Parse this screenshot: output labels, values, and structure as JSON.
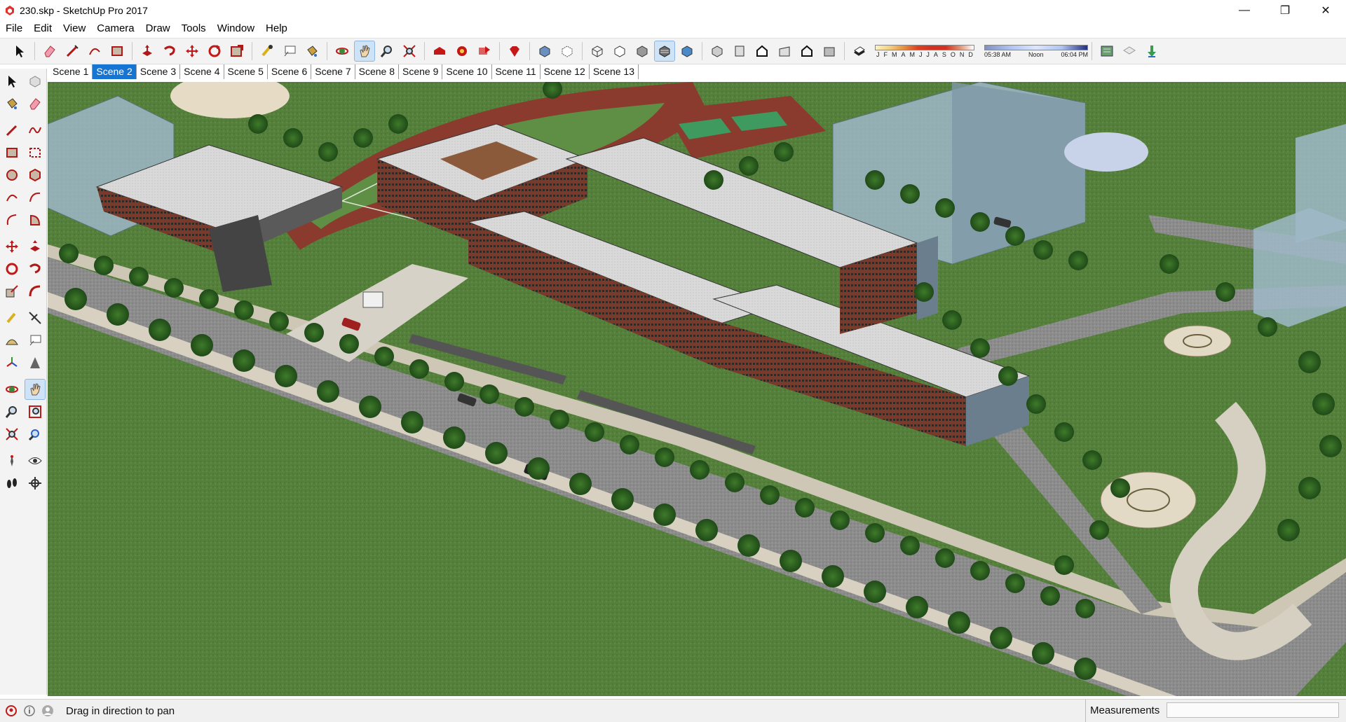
{
  "window": {
    "title": "230.skp - SketchUp Pro 2017",
    "controls": {
      "minimize": "—",
      "maximize": "❐",
      "close": "✕"
    }
  },
  "menu": [
    "File",
    "Edit",
    "View",
    "Camera",
    "Draw",
    "Tools",
    "Window",
    "Help"
  ],
  "shadow": {
    "months": [
      "J",
      "F",
      "M",
      "A",
      "M",
      "J",
      "J",
      "A",
      "S",
      "O",
      "N",
      "D"
    ],
    "time_start": "05:38 AM",
    "time_mid": "Noon",
    "time_end": "06:04 PM"
  },
  "scenes": [
    "Scene 1",
    "Scene 2",
    "Scene 3",
    "Scene 4",
    "Scene 5",
    "Scene 6",
    "Scene 7",
    "Scene 8",
    "Scene 9",
    "Scene 10",
    "Scene 11",
    "Scene 12",
    "Scene 13"
  ],
  "active_scene": 1,
  "status": {
    "message": "Drag in direction to pan",
    "measurements_label": "Measurements",
    "measurements_value": ""
  },
  "colors": {
    "accent": "#1674d2",
    "grass": "#4f7a3a",
    "road": "#8a8a8a",
    "brick": "#7a3a2a",
    "glass": "#9fb8c8",
    "track": "#8a3b2e"
  },
  "icons": {
    "toolbar": [
      "select-icon",
      "eraser-icon",
      "line-icon",
      "arc-icon",
      "rectangle-icon",
      "push-pull-icon",
      "follow-me-icon",
      "move-icon",
      "rotate-icon",
      "offset-icon",
      "tape-measure-icon",
      "text-icon",
      "paint-bucket-icon",
      "orbit-icon",
      "pan-icon",
      "zoom-icon",
      "zoom-extents-icon",
      "warehouse-icon",
      "extension-icon",
      "share-model-icon",
      "ruby-icon",
      "xray-icon",
      "back-edges-icon",
      "wireframe-icon",
      "hidden-line-icon",
      "shaded-icon",
      "shaded-textures-icon",
      "monochrome-icon",
      "iso-view-icon",
      "top-view-icon",
      "front-view-icon",
      "right-view-icon",
      "back-view-icon",
      "left-view-icon",
      "shadows-toggle-icon",
      "geo-location-icon",
      "fog-icon",
      "sandbox-icon"
    ]
  }
}
